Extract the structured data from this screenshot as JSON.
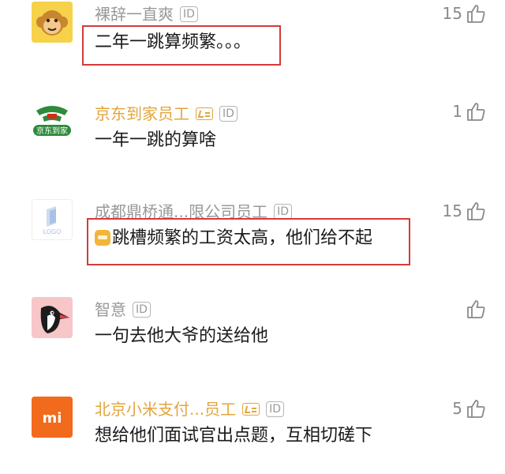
{
  "comments": [
    {
      "username": "裸辞一直爽",
      "id_badge": "ID",
      "text": "二年一跳算频繁。。。",
      "likes": "15",
      "verified": false,
      "highlighted": true,
      "avatar": "monkey-face-icon"
    },
    {
      "username": "京东到家员工",
      "id_badge": "ID",
      "text": "一年一跳的算啥",
      "likes": "1",
      "verified": true,
      "highlighted": false,
      "avatar": "jd-daojia-logo",
      "avatar_text": "京东到家"
    },
    {
      "username": "成都鼎桥通...限公司员工",
      "id_badge": "ID",
      "text": "跳槽频繁的工资太高，他们给不起",
      "likes": "15",
      "verified": false,
      "highlighted": true,
      "avatar": "logo-placeholder-icon",
      "avatar_text": "LOGO"
    },
    {
      "username": "智意",
      "id_badge": "ID",
      "text": "一句去他大爷的送给他",
      "likes": "",
      "verified": false,
      "highlighted": false,
      "avatar": "woodpecker-icon"
    },
    {
      "username": "北京小米支付...员工",
      "id_badge": "ID",
      "text": "想给他们面试官出点题，互相切磋下",
      "likes": "5",
      "verified": true,
      "highlighted": false,
      "avatar": "mi-logo",
      "avatar_text": "mi"
    }
  ],
  "colors": {
    "verified_name": "#e3a53c",
    "plain_name": "#999999",
    "highlight_border": "#d43a3a",
    "mi_orange": "#f26a1b"
  }
}
